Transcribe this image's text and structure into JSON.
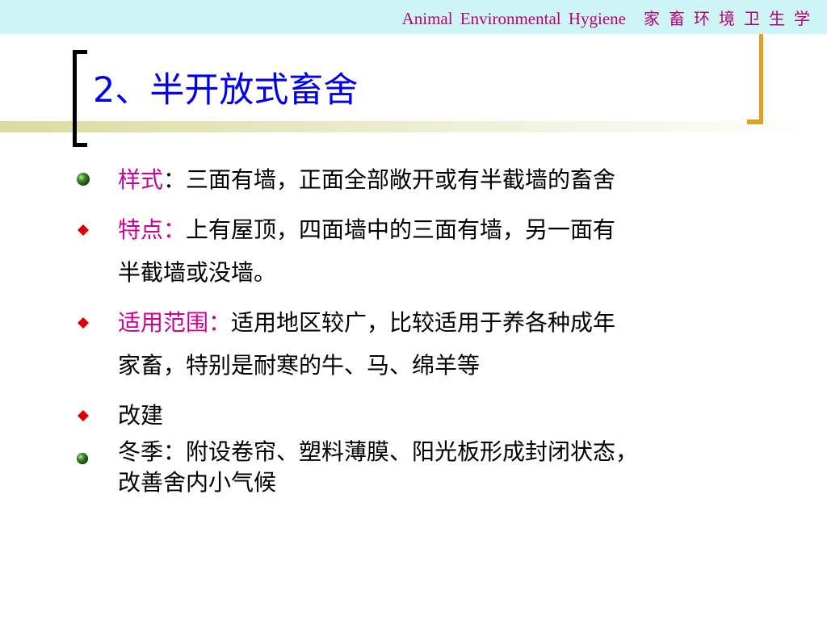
{
  "header": {
    "course_en": "Animal  Environmental  Hygiene",
    "course_cn": "家畜环境卫生学"
  },
  "slide": {
    "title": "2、半开放式畜舍"
  },
  "bullets": [
    {
      "icon": "green-sphere-bullet-icon",
      "label": "样式",
      "colon": "：",
      "lines": [
        "三面有墙，正面全部敞开或有半截墙的畜舍"
      ]
    },
    {
      "icon": "red-diamond-bullet-icon",
      "label": "特点：",
      "lines": [
        "上有屋顶，四面墙中的三面有墙，另一面有",
        "半截墙或没墙。"
      ]
    },
    {
      "icon": "red-diamond-bullet-icon",
      "label": "适用范围：",
      "lines": [
        "适用地区较广，比较适用于养各种成年",
        "家畜，特别是耐寒的牛、马、绵羊等"
      ]
    },
    {
      "icon": "red-diamond-bullet-icon",
      "lines": [
        "改建"
      ]
    },
    {
      "icon": "green-sphere-bullet-icon",
      "lines": [
        "冬季：附设卷帘、塑料薄膜、阳光板形成封闭状态，",
        "改善舍内小气候"
      ]
    }
  ],
  "colors": {
    "header_band": "#cdf5f5",
    "header_text": "#b8007a",
    "title": "#0000ee",
    "label": "#cc0099",
    "bracket_left": "#000000",
    "bracket_right": "#e0a020",
    "diamond": "#dd0000",
    "sphere": "#3a8a2a"
  }
}
